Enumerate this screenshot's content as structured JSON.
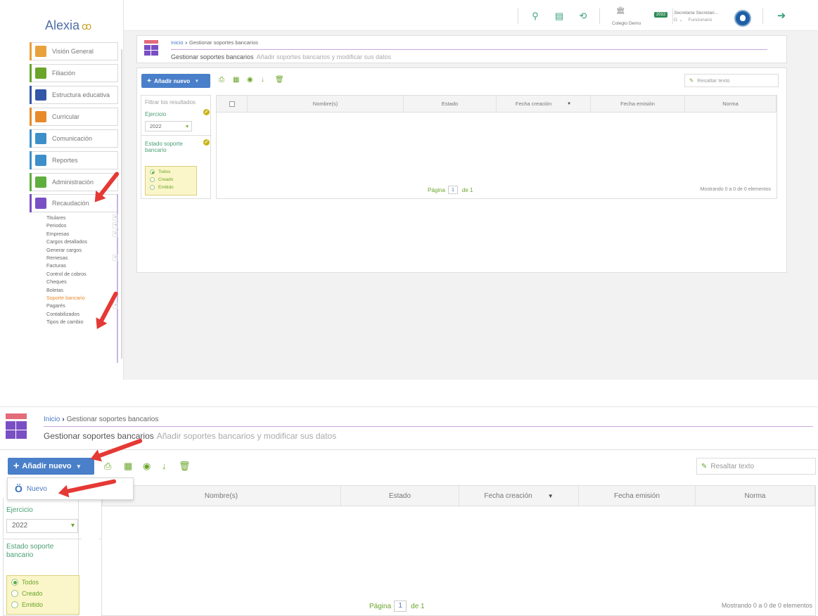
{
  "app": {
    "logo": "Alexia",
    "school": "Colegio Demo",
    "year_badge": "2022",
    "user_name": "Secretaria Secretari...",
    "user_role": "Funcionario",
    "user_initial": "G"
  },
  "sidebar": {
    "items": [
      {
        "label": "Visión General",
        "color": "#e8a13c"
      },
      {
        "label": "Filiación",
        "color": "#6aa52a"
      },
      {
        "label": "Estructura educativa",
        "color": "#3557a8"
      },
      {
        "label": "Curricular",
        "color": "#e8892c"
      },
      {
        "label": "Comunicación",
        "color": "#3d8fc9"
      },
      {
        "label": "Reportes",
        "color": "#3d8fc9"
      },
      {
        "label": "Administración",
        "color": "#5fae3e"
      },
      {
        "label": "Recaudación",
        "color": "#7a4fc4"
      }
    ],
    "subitems": [
      {
        "label": "Titulares",
        "plus": true
      },
      {
        "label": "Periodos",
        "plus": true
      },
      {
        "label": "Empresas",
        "plus": true
      },
      {
        "label": "Cargos detallados",
        "plus": false
      },
      {
        "label": "Generar cargos",
        "plus": false
      },
      {
        "label": "Remesas",
        "plus": true
      },
      {
        "label": "Facturas",
        "plus": false
      },
      {
        "label": "Control de cobros",
        "plus": false
      },
      {
        "label": "Cheques",
        "plus": false
      },
      {
        "label": "Boletas",
        "plus": false
      },
      {
        "label": "Soporte bancario",
        "plus": false,
        "active": true
      },
      {
        "label": "Pagarés",
        "plus": true
      },
      {
        "label": "Contabilizados",
        "plus": false
      },
      {
        "label": "Tipos de cambio",
        "plus": false
      }
    ]
  },
  "breadcrumb": {
    "home": "Inicio",
    "current": "Gestionar soportes bancarios"
  },
  "page": {
    "title": "Gestionar soportes bancarios",
    "subtitle": "Añadir soportes bancarios y modificar sus datos"
  },
  "toolbar": {
    "add_label": "Añadir nuevo",
    "highlight_placeholder": "Resaltar texto"
  },
  "filter": {
    "placeholder": "Filtrar los resultados",
    "ejercicio_label": "Ejercicio",
    "ejercicio_value": "2022",
    "estado_label": "Estado soporte bancario",
    "options": [
      "Todos",
      "Creado",
      "Emitido"
    ],
    "selected": "Todos"
  },
  "grid": {
    "columns": [
      "Nombre(s)",
      "Estado",
      "Fecha creación",
      "Fecha emisión",
      "Norma"
    ],
    "page_label": "Página",
    "page_num": "1",
    "page_of": "de 1",
    "showing": "Mostrando 0 a 0 de 0 elementos"
  },
  "dropdown": {
    "nuevo_label": "Nuevo"
  },
  "colors": {
    "accent_blue": "#4a7fc9",
    "accent_green": "#6aa52a",
    "annotation_red": "#e53935"
  }
}
